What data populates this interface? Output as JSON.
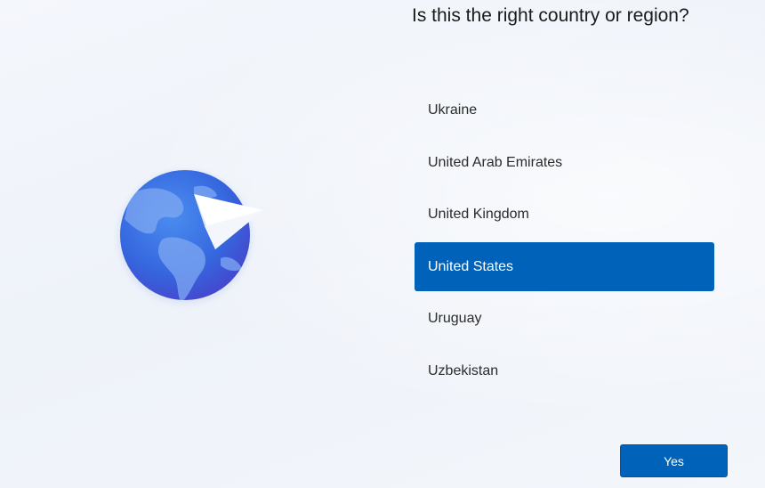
{
  "header": {
    "title": "Is this the right country or region?"
  },
  "illustration": {
    "icon": "globe-with-paper-plane-icon",
    "colors": {
      "globe": "#3a6fe0",
      "land": "#7fa9f2",
      "plane": "#ffffff"
    }
  },
  "country_list": {
    "items": [
      {
        "label": "Ukraine",
        "selected": false
      },
      {
        "label": "United Arab Emirates",
        "selected": false
      },
      {
        "label": "United Kingdom",
        "selected": false
      },
      {
        "label": "United States",
        "selected": true
      },
      {
        "label": "Uruguay",
        "selected": false
      },
      {
        "label": "Uzbekistan",
        "selected": false
      }
    ],
    "selected_color": "#0062b8"
  },
  "footer": {
    "yes_label": "Yes"
  }
}
